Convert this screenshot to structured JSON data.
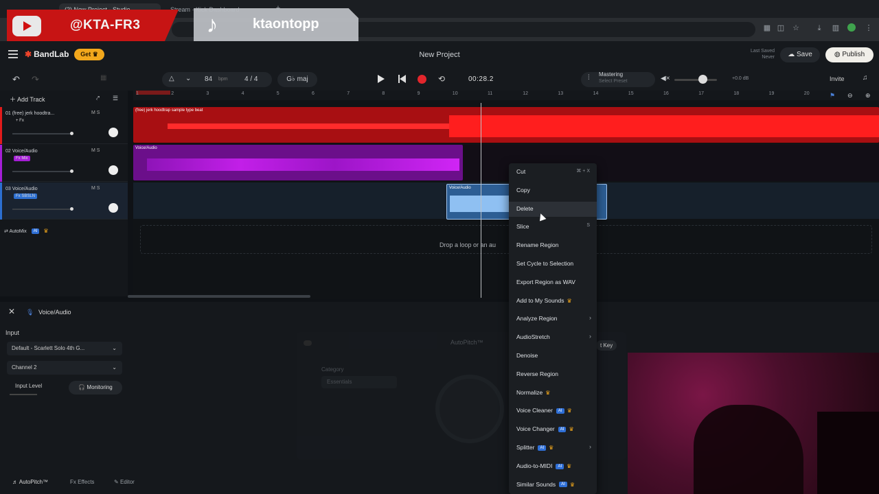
{
  "browser": {
    "tabs": [
      {
        "label": "(2) New Project - Studio",
        "active": true
      },
      {
        "label": "Stream · Kick Dashboard",
        "active": false
      }
    ]
  },
  "overlay": {
    "youtube_handle": "@KTA-FR3",
    "tiktok_handle": "ktaontopp"
  },
  "app": {
    "logo": "BandLab",
    "get_label": "Get",
    "project_title": "New Project",
    "last_saved_label": "Last Saved",
    "last_saved_value": "Never",
    "save_label": "Save",
    "publish_label": "Publish",
    "invite_label": "Invite"
  },
  "toolbar": {
    "bpm": "84",
    "bpm_unit": "bpm",
    "time_sig": "4 / 4",
    "key": "G♭ maj",
    "time": "00:28.2",
    "mastering_label": "Mastering",
    "mastering_sub": "Select Preset",
    "db": "+0.0 dB"
  },
  "tracks": {
    "add_label": "Add Track",
    "items": [
      {
        "name": "01  (free) jerk hoodtra...",
        "fx": "+ Fx",
        "color": "#e01b1b"
      },
      {
        "name": "02  Voice/Audio",
        "fx": "Fx Mix",
        "color": "#a51ed6"
      },
      {
        "name": "03  Voice/Audio",
        "fx": "Fx SBSLN",
        "color": "#2c6fd1"
      }
    ],
    "ms": "M   S",
    "automix": "AutoMix",
    "ai_badge": "AI"
  },
  "ruler": [
    "1",
    "2",
    "3",
    "4",
    "5",
    "6",
    "7",
    "8",
    "9",
    "10",
    "11",
    "12",
    "13",
    "14",
    "15",
    "16",
    "17",
    "18",
    "19",
    "20"
  ],
  "regions": {
    "r1": "(free) jerk hoodtrap sample type beat",
    "r2": "Voice/Audio",
    "r3": "Voice/Audio"
  },
  "drop_text": "Drop a loop or an au",
  "editor": {
    "title": "Voice/Audio",
    "input_label": "Input",
    "input_device": "Default - Scarlett Solo 4th G...",
    "channel": "Channel 2",
    "input_level": "Input Level",
    "monitoring": "Monitoring",
    "autopitch_title": "AutoPitch™",
    "category_label": "Category",
    "category_value": "Essentials",
    "key_label": "t Key",
    "tabs": [
      "AutoPitch™",
      "Effects",
      "Editor"
    ]
  },
  "context_menu": [
    {
      "label": "Cut",
      "shortcut": "⌘ + X"
    },
    {
      "label": "Copy",
      "shortcut": ""
    },
    {
      "label": "Delete",
      "shortcut": "",
      "hover": true
    },
    {
      "label": "Slice",
      "shortcut": "S"
    },
    {
      "label": "Rename Region"
    },
    {
      "label": "Set Cycle to Selection"
    },
    {
      "label": "Export Region as WAV"
    },
    {
      "label": "Add to My Sounds",
      "crown": true
    },
    {
      "label": "Analyze Region",
      "submenu": true
    },
    {
      "label": "AudioStretch",
      "submenu": true
    },
    {
      "label": "Denoise"
    },
    {
      "label": "Reverse Region"
    },
    {
      "label": "Normalize",
      "crown": true
    },
    {
      "label": "Voice Cleaner",
      "ai": true,
      "crown": true
    },
    {
      "label": "Voice Changer",
      "ai": true,
      "crown": true
    },
    {
      "label": "Splitter",
      "ai": true,
      "crown": true,
      "submenu": true
    },
    {
      "label": "Audio-to-MIDI",
      "ai": true,
      "crown": true
    },
    {
      "label": "Similar Sounds",
      "ai": true,
      "crown": true
    }
  ]
}
